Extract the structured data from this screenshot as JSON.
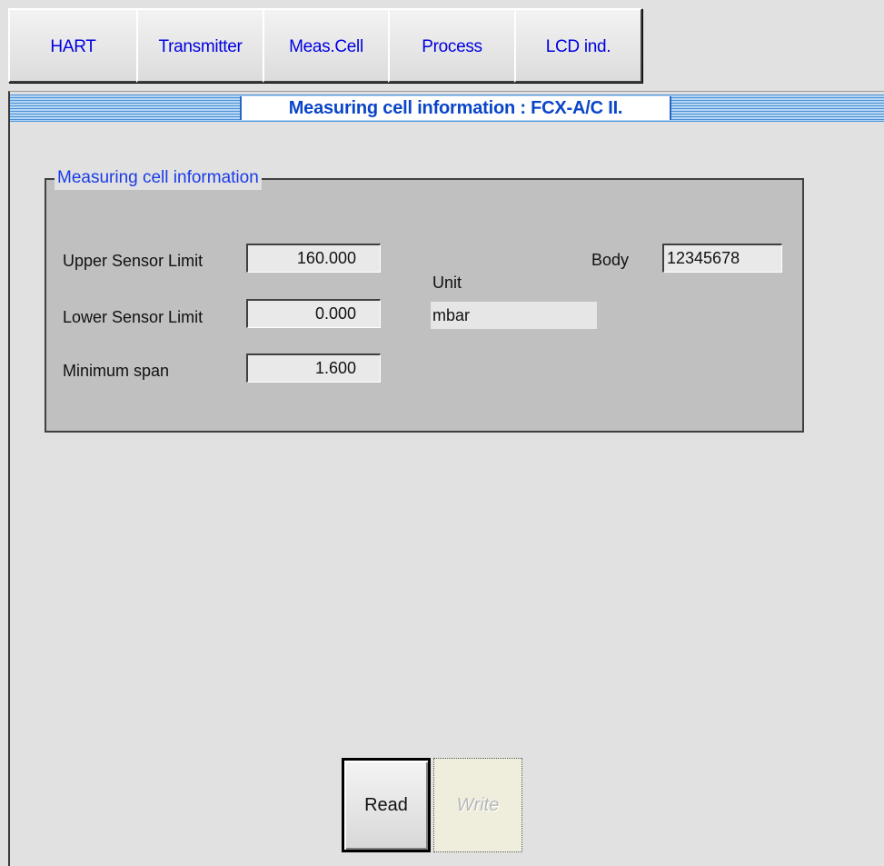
{
  "tabs": [
    {
      "label": "HART"
    },
    {
      "label": "Transmitter"
    },
    {
      "label": "Meas.Cell"
    },
    {
      "label": "Process"
    },
    {
      "label": "LCD ind."
    }
  ],
  "header": {
    "title": "Measuring cell information : FCX-A/C II."
  },
  "group": {
    "legend": "Measuring cell information",
    "upper_label": "Upper Sensor Limit",
    "upper_value": "160.000",
    "lower_label": "Lower Sensor Limit",
    "lower_value": "0.000",
    "span_label": "Minimum span",
    "span_value": "1.600",
    "unit_label": "Unit",
    "unit_value": "mbar",
    "body_label": "Body",
    "body_value": "12345678"
  },
  "buttons": {
    "read": "Read",
    "write": "Write"
  }
}
